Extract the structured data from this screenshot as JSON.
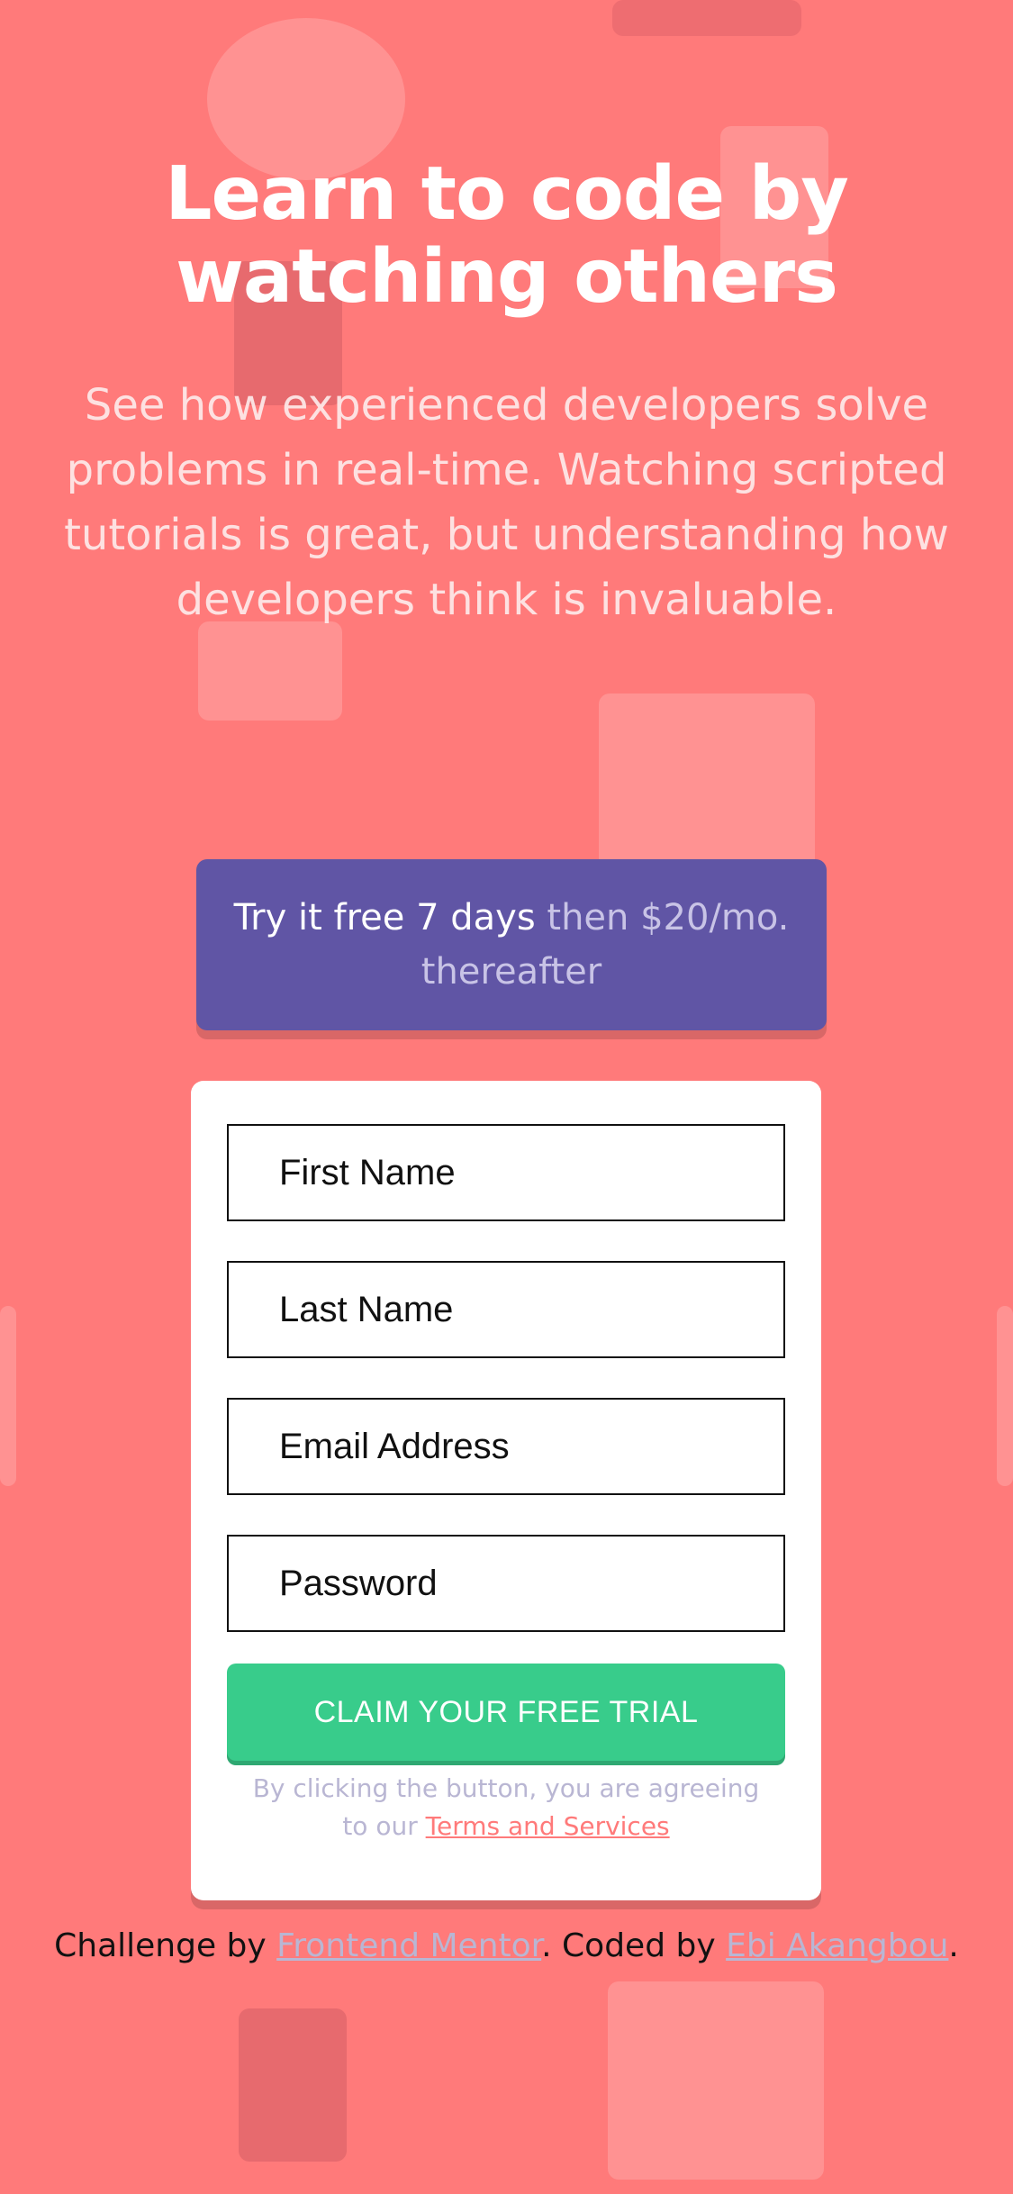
{
  "hero": {
    "title": "Learn to code by watching others",
    "subtitle": "See how experienced developers solve problems in real-time. Watching scripted tutorials is great, but understanding how developers think is invaluable."
  },
  "offer": {
    "strong": "Try it free 7 days",
    "light": "then $20/mo. thereafter"
  },
  "form": {
    "first_name_placeholder": "First Name",
    "last_name_placeholder": "Last Name",
    "email_placeholder": "Email Address",
    "password_placeholder": "Password",
    "submit_label": "CLAIM YOUR FREE TRIAL",
    "terms_prefix": "By clicking the button, you are agreeing to our",
    "terms_link": "Terms and Services"
  },
  "footer": {
    "prefix": "Challenge by",
    "link1": "Frontend Mentor",
    "middle": ". Coded by",
    "link2": "Ebi Akangbou",
    "suffix": "."
  },
  "colors": {
    "background": "#ff7a7a",
    "offer_bg": "#6055a5",
    "cta_bg": "#38cc8b",
    "link_muted": "#b9b6d3"
  }
}
